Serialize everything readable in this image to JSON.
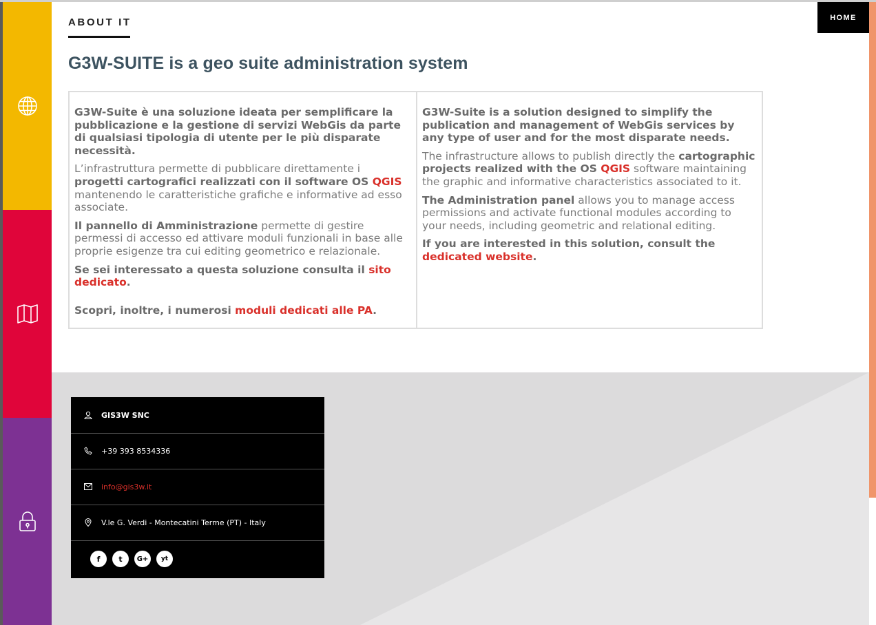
{
  "nav": {
    "home_label": "HOME"
  },
  "sidebar": {
    "items": [
      {
        "icon": "globe-icon",
        "color": "#f3b800"
      },
      {
        "icon": "map-icon",
        "color": "#e0053a"
      },
      {
        "icon": "lock-icon",
        "color": "#7d3193"
      }
    ]
  },
  "section": {
    "title": "ABOUT IT",
    "headline": "G3W-SUITE is a geo suite administration system"
  },
  "left_col": {
    "p1": "G3W-Suite è una soluzione ideata per semplificare la pubblicazione e la gestione di servizi WebGis da parte di qualsiasi tipologia di utente per le più disparate necessità.",
    "p2_start": "L’infrastruttura permette di pubblicare direttamente i ",
    "p2_bold": "progetti cartografici realizzati con il software OS ",
    "p2_link": "QGIS",
    "p2_end": " mantenendo le caratteristiche grafiche e informative ad esso associate.",
    "p3_bold": "Il pannello di Amministrazione",
    "p3_end": " permette di gestire permessi di accesso ed attivare moduli funzionali in base alle proprie esigenze tra cui editing geometrico e relazionale.",
    "p4_bold": "Se sei interessato a questa soluzione consulta il ",
    "p4_link": "sito dedicato",
    "p4_end": ".",
    "p5_bold": "Scopri, inoltre,  i numerosi ",
    "p5_link": "moduli dedicati alle PA",
    "p5_end": "."
  },
  "right_col": {
    "p1": "G3W-Suite is a solution designed to simplify the publication and management of WebGis services by any type of user and for the most disparate needs.",
    "p2_start": "The infrastructure allows to publish directly the ",
    "p2_bold": "cartographic projects realized with the OS ",
    "p2_link": "QGIS",
    "p2_end": " software maintaining the graphic and informative characteristics associated to it.",
    "p3_bold": "The Administration panel",
    "p3_end": " allows you to manage access permissions and activate functional modules according to your needs, including geometric and relational editing.",
    "p4_bold": "If you are interested in this solution, consult the ",
    "p4_link": "dedicated website",
    "p4_end": "."
  },
  "contact": {
    "company": "GIS3W SNC",
    "phone": "+39 393 8534336",
    "email": "info@gis3w.it",
    "address": "V.le G. Verdi - Montecatini Terme (PT) - Italy",
    "socials": [
      "f",
      "t",
      "G+",
      "yt"
    ]
  },
  "colors": {
    "accent_red": "#d9302a",
    "headline": "#3d5360",
    "right_accent": "#f0956a"
  }
}
